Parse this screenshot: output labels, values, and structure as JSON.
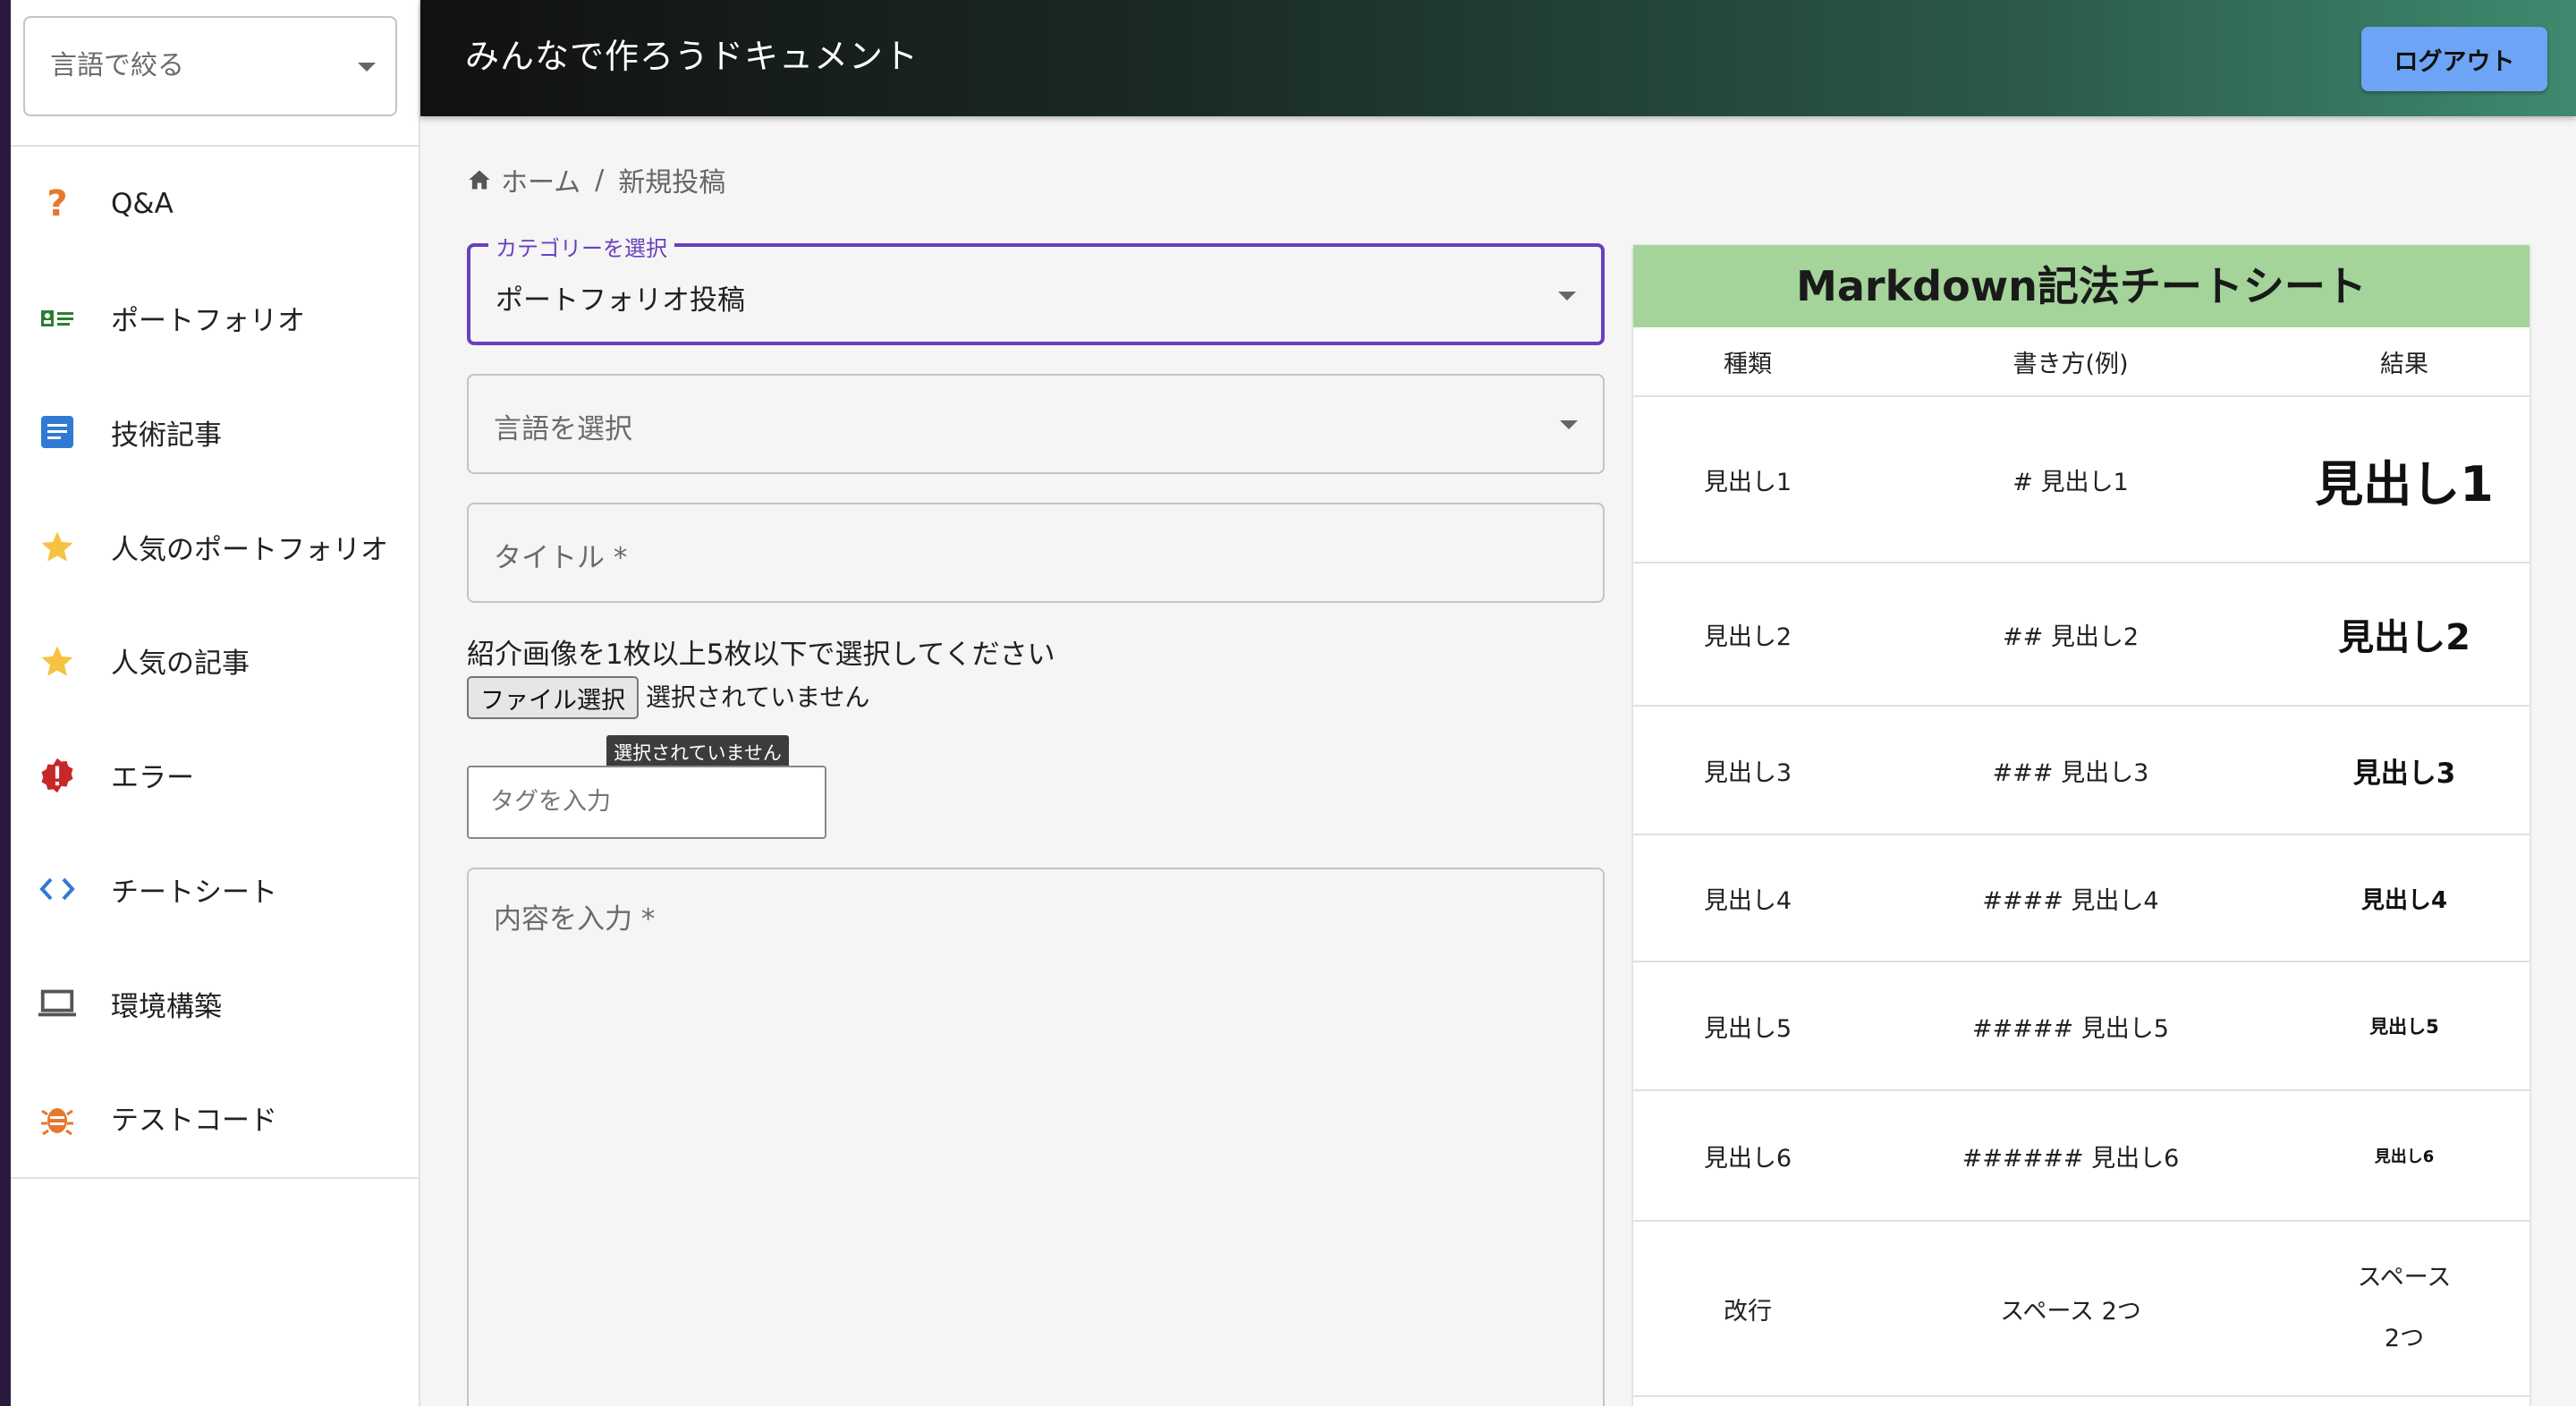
{
  "sidebar": {
    "filter_placeholder": "言語で絞る",
    "items": [
      {
        "label": "Q&A",
        "icon": "question-icon"
      },
      {
        "label": "ポートフォリオ",
        "icon": "portfolio-card-icon"
      },
      {
        "label": "技術記事",
        "icon": "article-icon"
      },
      {
        "label": "人気のポートフォリオ",
        "icon": "star-icon"
      },
      {
        "label": "人気の記事",
        "icon": "star-icon"
      },
      {
        "label": "エラー",
        "icon": "error-icon"
      },
      {
        "label": "チートシート",
        "icon": "code-icon"
      },
      {
        "label": "環境構築",
        "icon": "laptop-icon"
      },
      {
        "label": "テストコード",
        "icon": "bug-icon"
      }
    ]
  },
  "header": {
    "title": "みんなで作ろうドキュメント",
    "logout_label": "ログアウト"
  },
  "breadcrumb": {
    "home": "ホーム",
    "separator": "/",
    "current": "新規投稿"
  },
  "form": {
    "category_legend": "カテゴリーを選択",
    "category_value": "ポートフォリオ投稿",
    "language_placeholder": "言語を選択",
    "title_placeholder": "タイトル *",
    "image_label": "紹介画像を1枚以上5枚以下で選択してください",
    "file_button": "ファイル選択",
    "file_status": "選択されていません",
    "file_tooltip": "選択されていません",
    "tag_placeholder": "タグを入力",
    "content_placeholder": "内容を入力 *"
  },
  "cheatsheet": {
    "title": "Markdown記法チートシート",
    "columns": [
      "種類",
      "書き方(例)",
      "結果"
    ],
    "rows": [
      {
        "kind": "見出し1",
        "syntax": "# 見出し1",
        "result": "見出し1"
      },
      {
        "kind": "見出し2",
        "syntax": "## 見出し2",
        "result": "見出し2"
      },
      {
        "kind": "見出し3",
        "syntax": "### 見出し3",
        "result": "見出し3"
      },
      {
        "kind": "見出し4",
        "syntax": "#### 見出し4",
        "result": "見出し4"
      },
      {
        "kind": "見出し5",
        "syntax": "##### 見出し5",
        "result": "見出し5"
      },
      {
        "kind": "見出し6",
        "syntax": "###### 見出し6",
        "result": "見出し6"
      },
      {
        "kind": "改行",
        "syntax": "スペース 2つ",
        "result_line1": "スペース",
        "result_line2": "2つ"
      }
    ]
  },
  "colors": {
    "accent": "#6a3fc0",
    "logout_button": "#6ea4f5",
    "cheatsheet_header": "#a4d49a"
  }
}
